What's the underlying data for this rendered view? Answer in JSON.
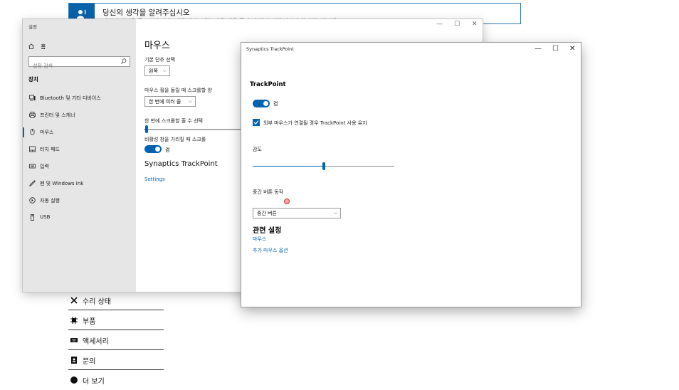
{
  "background_page": {
    "banner": {
      "title": "당신의 생각을 알려주십시오",
      "subtitle": "당신의 의견을 듣고 싶습니다. 전체 사이트에는 마우 생을 듣던 의 변경 사항 이어서 참여해보십시오."
    },
    "list": [
      {
        "label": "수리 상태",
        "icon": "wrench-icon"
      },
      {
        "label": "부품",
        "icon": "chip-icon"
      },
      {
        "label": "액세서리",
        "icon": "keyboard-icon"
      },
      {
        "label": "문의",
        "icon": "contact-icon"
      },
      {
        "label": "더 보기",
        "icon": "more-icon"
      }
    ]
  },
  "settings_window": {
    "title": "설정",
    "controls": {
      "minimize": "—",
      "maximize": "☐",
      "close": "✕"
    },
    "sidebar": {
      "home": "홈",
      "search_placeholder": "설정 검색",
      "category": "장치",
      "items": [
        {
          "label": "Bluetooth 및 기타 디바이스",
          "icon": "bluetooth-devices-icon"
        },
        {
          "label": "프린터 및 스캐너",
          "icon": "printer-icon"
        },
        {
          "label": "마우스",
          "icon": "mouse-icon",
          "active": true
        },
        {
          "label": "터치 패드",
          "icon": "touchpad-icon"
        },
        {
          "label": "입력",
          "icon": "keyboard-icon"
        },
        {
          "label": "펜 및 Windows Ink",
          "icon": "pen-icon"
        },
        {
          "label": "자동 실행",
          "icon": "autoplay-icon"
        },
        {
          "label": "USB",
          "icon": "usb-icon"
        }
      ]
    },
    "main": {
      "title": "마우스",
      "primary_button_label": "기본 단추 선택",
      "primary_button_value": "왼쪽",
      "scroll_wheel_label": "마우스 휠을 돌릴 때 스크롤할 양",
      "scroll_wheel_value": "한 번에 여러 줄",
      "lines_label": "한 번에 스크롤할 줄 수 선택",
      "lines_slider_fraction": 0.02,
      "inactive_scroll_label": "비활성 창을 가리킬 때 스크롤",
      "inactive_scroll_state": "켬",
      "section": "Synaptics TrackPoint",
      "settings_link": "Settings"
    }
  },
  "trackpoint_window": {
    "title": "Synaptics TrackPoint",
    "controls": {
      "minimize": "—",
      "maximize": "☐",
      "close": "✕"
    },
    "heading": "TrackPoint",
    "toggle_state": "켬",
    "checkbox_label": "외부 마우스가 연결될 경우 TrackPoint 사용 유지",
    "checkbox_checked": true,
    "sensitivity_label": "감도",
    "sensitivity_fraction": 0.5,
    "middle_button_label": "중간 버튼 동작",
    "middle_button_value": "중간 버튼",
    "related_title": "관련 설정",
    "related_links": [
      "마우스",
      "추가 마우스 옵션"
    ]
  },
  "colors": {
    "accent": "#0063b1",
    "sidebar_bg": "#e6e6e6",
    "banner_icon": "#0a62a8"
  }
}
